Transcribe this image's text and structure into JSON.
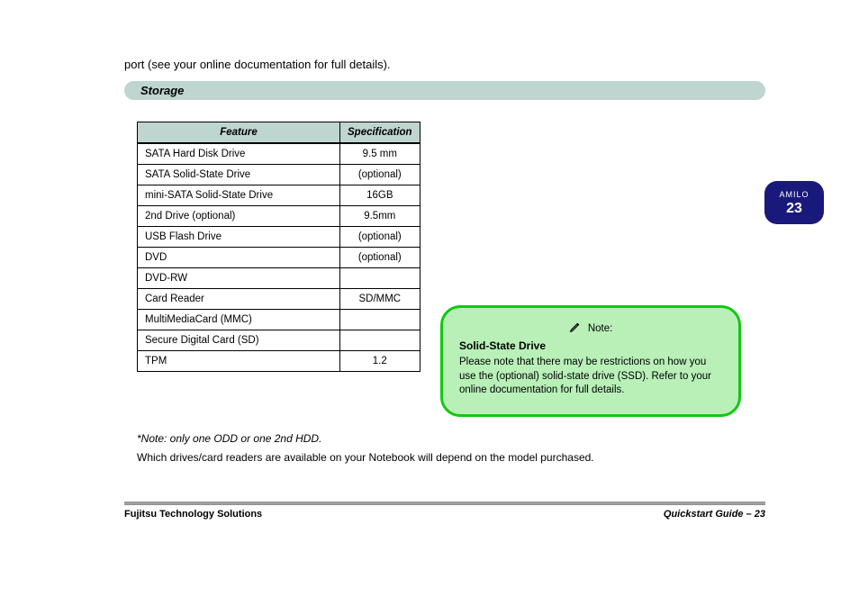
{
  "lead_text": "port (see your online documentation for full details).",
  "section_title": "Storage",
  "table": {
    "header_feature": "Feature",
    "header_spec": "Specification",
    "rows": [
      {
        "label": "SATA Hard Disk Drive",
        "value": "9.5 mm"
      },
      {
        "label": "SATA Solid-State Drive",
        "value": "(optional)"
      },
      {
        "label": "mini-SATA Solid-State Drive",
        "value": "16GB"
      },
      {
        "label": "2nd Drive (optional)",
        "value": "9.5mm"
      },
      {
        "label": "USB Flash Drive",
        "value": "(optional)"
      },
      {
        "label": "DVD",
        "value": "(optional)"
      },
      {
        "label": "DVD-RW",
        "value": ""
      },
      {
        "label": "Card Reader",
        "value": "SD/MMC"
      },
      {
        "label": "MultiMediaCard (MMC)",
        "value": ""
      },
      {
        "label": "Secure Digital Card (SD)",
        "value": ""
      },
      {
        "label": "TPM",
        "value": "1.2"
      }
    ]
  },
  "below_line1": "*Note: only one ODD or one 2nd HDD.",
  "below_line2": "Which drives/card readers are available on your Notebook will depend on the model purchased.",
  "note": {
    "head_label": "Note:",
    "sub": "Solid-State Drive",
    "body": "Please note that there may be restrictions on how you use the (optional) solid-state drive (SSD). Refer to your online documentation for full details."
  },
  "page_label": "AMILO",
  "page_number": "23",
  "footer_left": "Fujitsu Technology Solutions",
  "footer_right": "Quickstart Guide – 23"
}
